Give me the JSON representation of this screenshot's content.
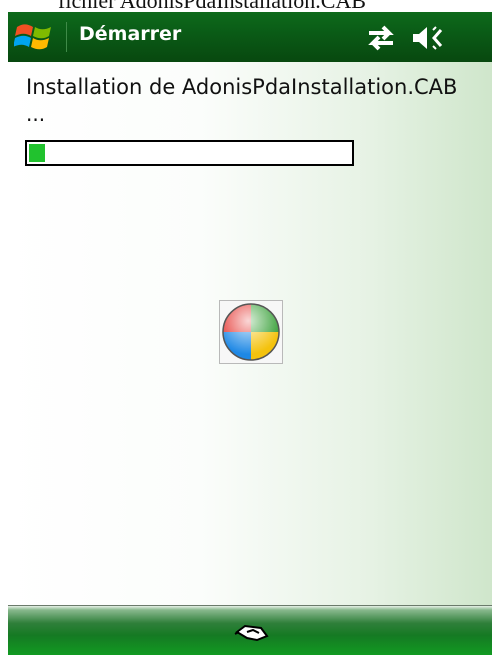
{
  "window": {
    "title": "fichier AdonisPdaInstallation.CAB"
  },
  "titlebar": {
    "title": "Démarrer"
  },
  "status": {
    "message": "Installation de AdonisPdaInstallation.CAB",
    "ellipsis": "...",
    "progress": 0.05
  },
  "colors": {
    "titlebar": "#0a5a16",
    "progress_fill": "#21c22e",
    "bottombar": "#157a23"
  },
  "icons": {
    "start": "windows-flag-icon",
    "connectivity": "connectivity-icon",
    "volume": "volume-muted-icon",
    "busy": "busy-wheel-icon",
    "keyboard": "sip-keyboard-icon"
  }
}
